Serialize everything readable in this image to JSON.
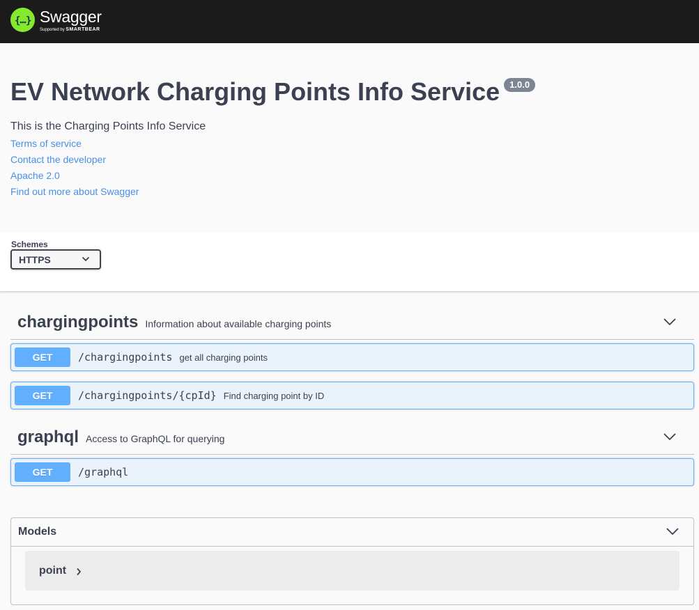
{
  "topbar": {
    "logo_title": "Swagger",
    "logo_sub_prefix": "Supported by",
    "logo_sub_brand": "SMARTBEAR"
  },
  "info": {
    "title": "EV Network Charging Points Info Service",
    "version": "1.0.0",
    "description": "This is the Charging Points Info Service",
    "links": [
      "Terms of service",
      "Contact the developer",
      "Apache 2.0",
      "Find out more about Swagger"
    ]
  },
  "schemes": {
    "label": "Schemes",
    "selected": "HTTPS"
  },
  "tags": [
    {
      "name": "chargingpoints",
      "description": "Information about available charging points",
      "operations": [
        {
          "method": "GET",
          "path": "/chargingpoints",
          "summary": "get all charging points"
        },
        {
          "method": "GET",
          "path": "/chargingpoints/{cpId}",
          "summary": "Find charging point by ID"
        }
      ]
    },
    {
      "name": "graphql",
      "description": "Access to GraphQL for querying",
      "operations": [
        {
          "method": "GET",
          "path": "/graphql",
          "summary": ""
        }
      ]
    }
  ],
  "models": {
    "title": "Models",
    "items": [
      "point"
    ]
  },
  "colors": {
    "get_method": "#61affe",
    "link": "#4990e2",
    "topbar": "#1b1b1b",
    "logo_green": "#85ea2d"
  }
}
